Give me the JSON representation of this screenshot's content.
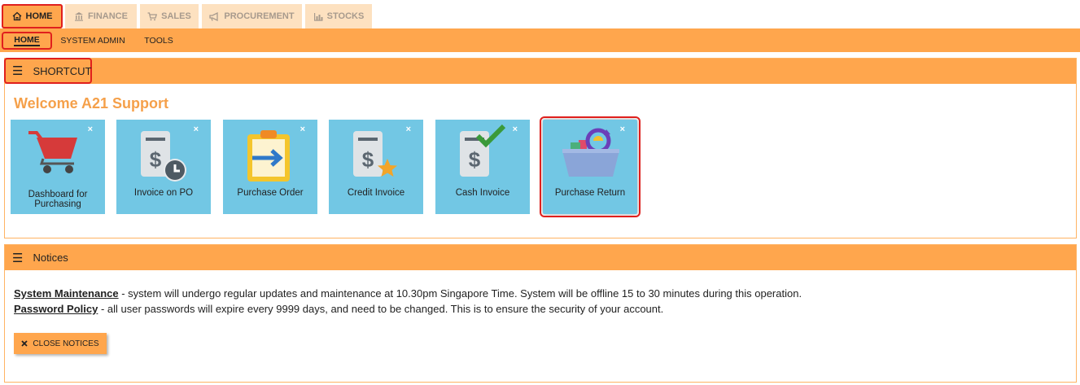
{
  "top_tabs": [
    {
      "label": "HOME",
      "icon": "home-icon"
    },
    {
      "label": "FINANCE",
      "icon": "bank-icon"
    },
    {
      "label": "SALES",
      "icon": "cart-icon"
    },
    {
      "label": "PROCUREMENT",
      "icon": "megaphone-icon"
    },
    {
      "label": "STOCKS",
      "icon": "bar-chart-icon"
    }
  ],
  "sub_nav": [
    "HOME",
    "SYSTEM ADMIN",
    "TOOLS"
  ],
  "shortcut": {
    "title": "SHORTCUT",
    "welcome": "Welcome A21 Support",
    "close_glyph": "×",
    "tiles": [
      {
        "label": "Dashboard for Purchasing",
        "icon": "shopping-cart-icon"
      },
      {
        "label": "Invoice on PO",
        "icon": "invoice-clock-icon"
      },
      {
        "label": "Purchase Order",
        "icon": "clipboard-arrow-icon"
      },
      {
        "label": "Credit Invoice",
        "icon": "invoice-star-icon"
      },
      {
        "label": "Cash Invoice",
        "icon": "invoice-check-icon"
      },
      {
        "label": "Purchase Return",
        "icon": "basket-return-icon"
      }
    ]
  },
  "notices": {
    "title": "Notices",
    "items": [
      {
        "heading": "System Maintenance",
        "text": " - system will undergo regular updates and maintenance at 10.30pm Singapore Time. System will be offline 15 to 30 minutes during this operation."
      },
      {
        "heading": "Password Policy",
        "text": " - all user passwords will expire every 9999 days, and need to be changed. This is to ensure the security of your account."
      }
    ],
    "close_button": "CLOSE NOTICES"
  },
  "colors": {
    "accent": "#ffa64d",
    "highlight": "#e0201d",
    "tile": "#72c7e4",
    "welcome": "#f5a04a"
  }
}
